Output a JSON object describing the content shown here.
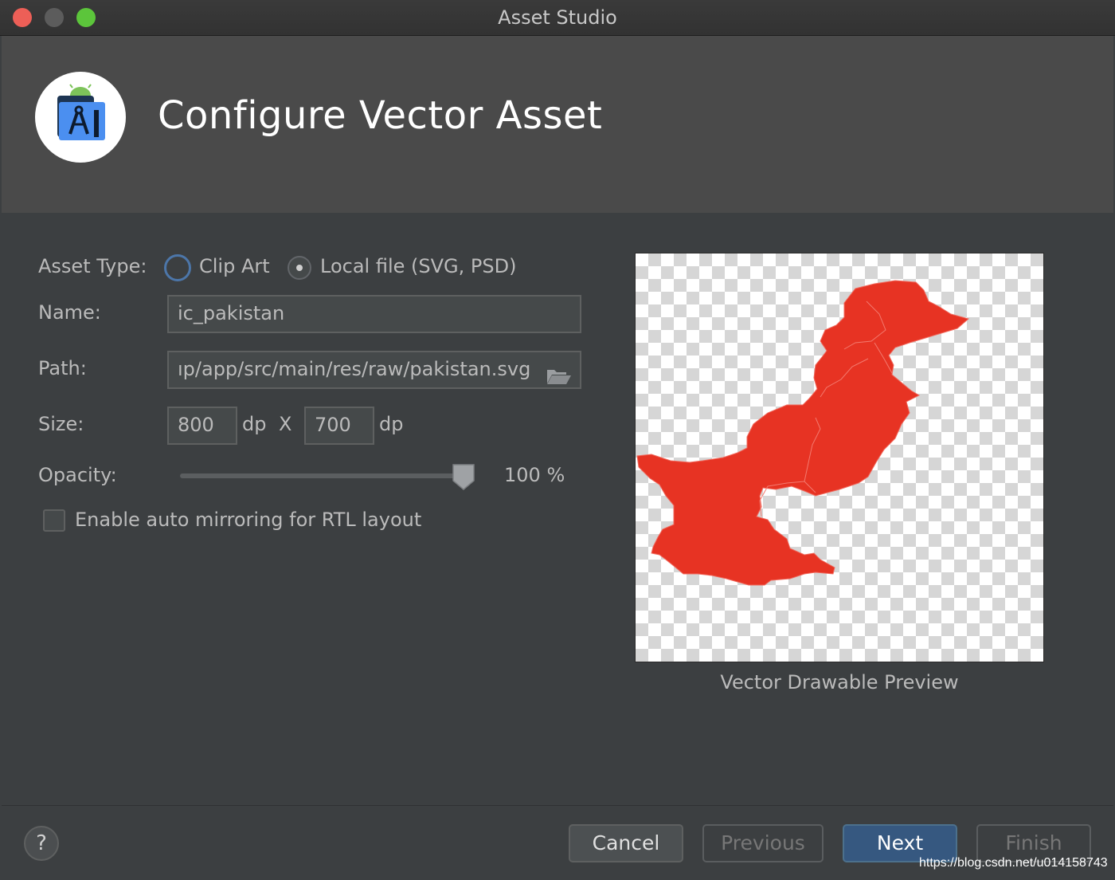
{
  "window": {
    "title": "Asset Studio",
    "buttons": [
      "close",
      "minimize",
      "maximize"
    ]
  },
  "header": {
    "title": "Configure Vector Asset",
    "logo_icon": "android-studio-icon"
  },
  "form": {
    "asset_type_label": "Asset Type:",
    "asset_type_options": [
      {
        "label": "Clip Art",
        "selected": false
      },
      {
        "label": "Local file (SVG, PSD)",
        "selected": true
      }
    ],
    "name_label": "Name:",
    "name_value": "ic_pakistan",
    "path_label": "Path:",
    "path_value": "ıp/app/src/main/res/raw/pakistan.svg",
    "size_label": "Size:",
    "width_value": "800",
    "width_unit": "dp",
    "size_separator": "X",
    "height_value": "700",
    "height_unit": "dp",
    "opacity_label": "Opacity:",
    "opacity_value": 100,
    "opacity_text": "100 %",
    "mirroring_label": "Enable auto mirroring for RTL layout",
    "mirroring_checked": false
  },
  "preview": {
    "caption": "Vector Drawable Preview",
    "fill_color": "#e73323",
    "checker_color": "#d6d6d6"
  },
  "footer": {
    "help_label": "?",
    "cancel_label": "Cancel",
    "previous_label": "Previous",
    "next_label": "Next",
    "finish_label": "Finish"
  },
  "watermark": "https://blog.csdn.net/u014158743"
}
